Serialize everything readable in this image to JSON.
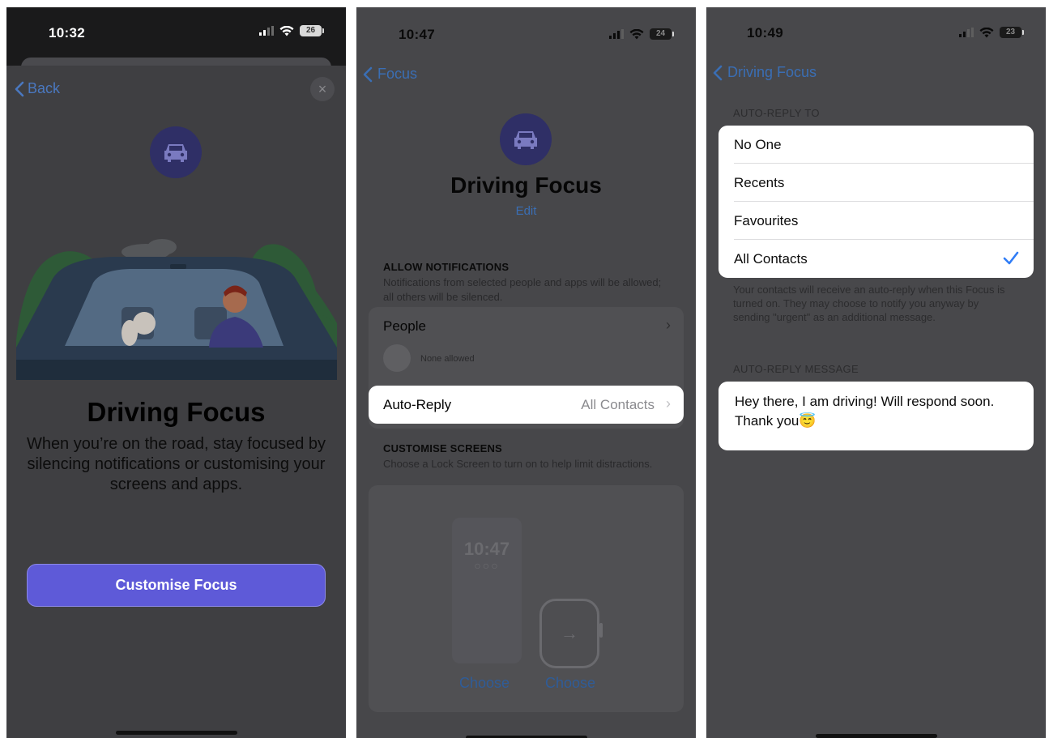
{
  "screens": [
    {
      "time": "10:32",
      "battery": "26",
      "back_label": "Back",
      "close_label": "×",
      "title": "Driving Focus",
      "description": "When you’re on the road, stay focused by silencing notifications or customising your screens and apps.",
      "cta_label": "Customise Focus",
      "icon": "car-icon"
    },
    {
      "time": "10:47",
      "battery": "24",
      "back_label": "Focus",
      "icon": "car-icon",
      "title": "Driving Focus",
      "edit_label": "Edit",
      "allow_notifications": {
        "heading": "ALLOW NOTIFICATIONS",
        "subtext": "Notifications from selected people and apps will be allowed; all others will be silenced.",
        "people_label": "People",
        "people_status": "None allowed"
      },
      "auto_reply": {
        "label": "Auto-Reply",
        "value": "All Contacts"
      },
      "customise_screens": {
        "heading": "CUSTOMISE SCREENS",
        "subtext": "Choose a Lock Screen to turn on to help limit distractions.",
        "lock_preview_time": "10:47",
        "choose_lock_label": "Choose",
        "choose_watch_label": "Choose"
      }
    },
    {
      "time": "10:49",
      "battery": "23",
      "back_label": "Driving Focus",
      "auto_reply_to_heading": "AUTO-REPLY TO",
      "options": [
        "No One",
        "Recents",
        "Favourites",
        "All Contacts"
      ],
      "selected_option": "All Contacts",
      "footer_text": "Your contacts will receive an auto-reply when this Focus is turned on. They may choose to notify you anyway by sending \"urgent\" as an additional message.",
      "message_heading": "AUTO-REPLY MESSAGE",
      "message": "Hey there, I am driving! Will respond soon. Thank you😇"
    }
  ],
  "colors": {
    "accent_blue": "#2f7cf6",
    "cta_purple": "#5e5ad8",
    "icon_circle": "#2f2f66"
  }
}
